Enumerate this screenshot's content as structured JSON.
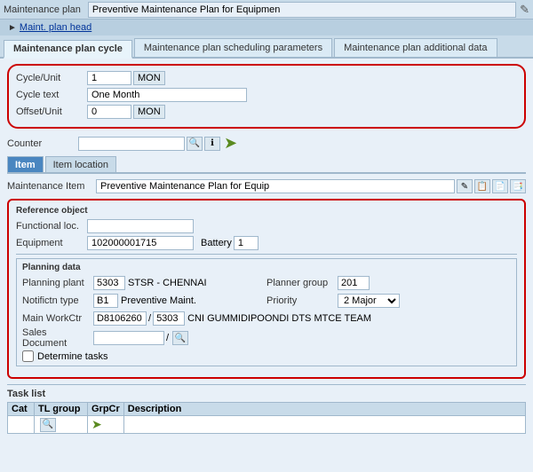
{
  "topBar": {
    "label": "Maintenance plan",
    "value": "Preventive Maintenance Plan for Equipmen",
    "editIcon": "✎"
  },
  "breadcrumb": {
    "link": "Maint. plan head",
    "arrow": "►"
  },
  "tabs": {
    "items": [
      {
        "label": "Maintenance plan cycle",
        "active": true
      },
      {
        "label": "Maintenance plan scheduling parameters",
        "active": false
      },
      {
        "label": "Maintenance plan additional data",
        "active": false
      }
    ]
  },
  "cycleSection": {
    "cycleUnit": {
      "label": "Cycle/Unit",
      "value": "1",
      "unit": "MON"
    },
    "cycleText": {
      "label": "Cycle text",
      "value": "One Month"
    },
    "offsetUnit": {
      "label": "Offset/Unit",
      "value": "0",
      "unit": "MON"
    }
  },
  "counter": {
    "label": "Counter",
    "value": ""
  },
  "innerTabs": {
    "items": [
      {
        "label": "Item",
        "active": true
      },
      {
        "label": "Item location",
        "active": false
      }
    ]
  },
  "maintenanceItem": {
    "label": "Maintenance Item",
    "value": "Preventive Maintenance Plan for Equip",
    "icons": [
      "✎",
      "📋",
      "📄",
      "📑"
    ]
  },
  "referenceObject": {
    "title": "Reference object",
    "functionalLoc": {
      "label": "Functional loc.",
      "value": ""
    },
    "equipment": {
      "label": "Equipment",
      "value": "102000001715"
    },
    "battery": {
      "label": "Battery",
      "value": "1"
    }
  },
  "planningData": {
    "title": "Planning data",
    "planningPlant": {
      "label": "Planning plant",
      "code": "5303",
      "name": "STSR - CHENNAI"
    },
    "plannerGroup": {
      "label": "Planner group",
      "value": "201"
    },
    "notifctnType": {
      "label": "Notifictn type",
      "code": "B1",
      "name": "Preventive Maint."
    },
    "priority": {
      "label": "Priority",
      "value": "2 Major"
    },
    "mainWorkCtr": {
      "label": "Main WorkCtr",
      "code1": "D8106260",
      "separator": "/",
      "code2": "5303",
      "name": "CNI GUMMIDIPOONDI DTS MTCE TEAM"
    },
    "salesDocument": {
      "label": "Sales Document",
      "value": "",
      "separator": "/"
    },
    "determineTasks": {
      "label": "Determine tasks",
      "checked": false
    }
  },
  "taskList": {
    "title": "Task list",
    "columns": [
      "Cat",
      "TL group",
      "GrpCr",
      "Description"
    ]
  }
}
